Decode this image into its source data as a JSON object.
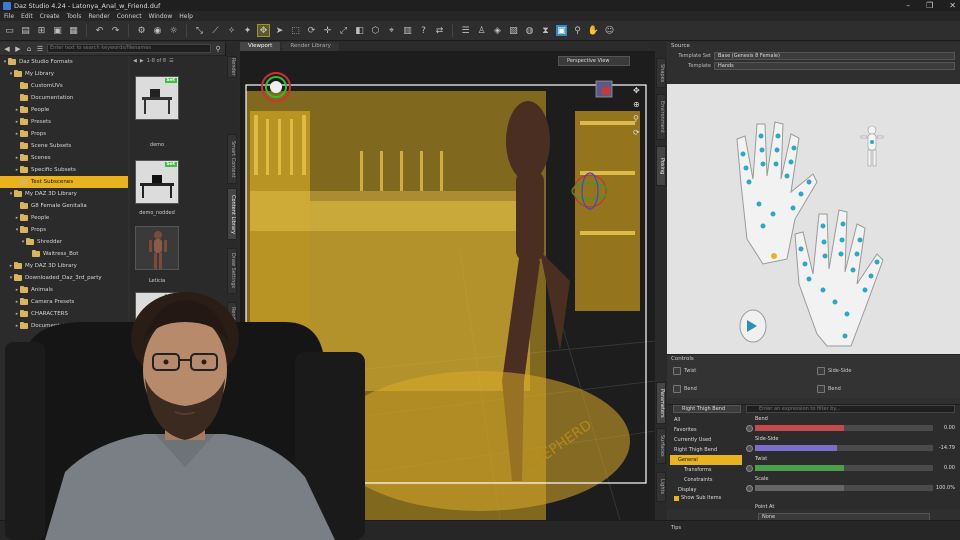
{
  "window": {
    "title": "Daz Studio 4.24 - Latonya_Anal_w_Friend.duf",
    "controls": [
      "–",
      "❐",
      "✕"
    ]
  },
  "menu": [
    "File",
    "Edit",
    "Create",
    "Tools",
    "Render",
    "Connect",
    "Window",
    "Help"
  ],
  "content_library": {
    "search_placeholder": "Enter text to search keywords/filenames",
    "page_indicator": "1-8 of 8",
    "tree": [
      {
        "label": "Daz Studio Formats",
        "depth": 0,
        "caret": "▾",
        "selected": false
      },
      {
        "label": "My Library",
        "depth": 1,
        "caret": "▾",
        "selected": false
      },
      {
        "label": "CustomUVs",
        "depth": 2,
        "caret": "",
        "selected": false
      },
      {
        "label": "Documentation",
        "depth": 2,
        "caret": "",
        "selected": false
      },
      {
        "label": "People",
        "depth": 2,
        "caret": "▸",
        "selected": false
      },
      {
        "label": "Presets",
        "depth": 2,
        "caret": "▸",
        "selected": false
      },
      {
        "label": "Props",
        "depth": 2,
        "caret": "▸",
        "selected": false
      },
      {
        "label": "Scene Subsets",
        "depth": 2,
        "caret": "",
        "selected": false
      },
      {
        "label": "Scenes",
        "depth": 2,
        "caret": "▸",
        "selected": false
      },
      {
        "label": "Specific Subsets",
        "depth": 2,
        "caret": "▸",
        "selected": false
      },
      {
        "label": "Test Subscenes",
        "depth": 2,
        "caret": "",
        "selected": true
      },
      {
        "label": "My DAZ 3D Library",
        "depth": 1,
        "caret": "▾",
        "selected": false
      },
      {
        "label": "G8 Female Genitalia",
        "depth": 2,
        "caret": "",
        "selected": false
      },
      {
        "label": "People",
        "depth": 2,
        "caret": "▸",
        "selected": false
      },
      {
        "label": "Props",
        "depth": 2,
        "caret": "▾",
        "selected": false
      },
      {
        "label": "Shredder",
        "depth": 3,
        "caret": "▾",
        "selected": false
      },
      {
        "label": "Waitress_Bot",
        "depth": 4,
        "caret": "",
        "selected": false
      },
      {
        "label": "My DAZ 3D Library",
        "depth": 1,
        "caret": "▸",
        "selected": false
      },
      {
        "label": "Downloaded_Daz_3rd_party",
        "depth": 1,
        "caret": "▾",
        "selected": false
      },
      {
        "label": "Animals",
        "depth": 2,
        "caret": "▸",
        "selected": false
      },
      {
        "label": "Camera Presets",
        "depth": 2,
        "caret": "▸",
        "selected": false
      },
      {
        "label": "CHARACTERS",
        "depth": 2,
        "caret": "▸",
        "selected": false
      },
      {
        "label": "Documentation",
        "depth": 2,
        "caret": "▸",
        "selected": false
      }
    ],
    "thumbs": [
      {
        "label": "demo",
        "badge": "Set"
      },
      {
        "label": "demo_nodded",
        "badge": "Set"
      },
      {
        "label": "Leticia",
        "badge": "Set"
      },
      {
        "label": "",
        "badge": "Set"
      }
    ],
    "side_tabs": [
      "Smart Content",
      "Content Library",
      "Draw Settings",
      "Render Settings"
    ],
    "top_tab": "Render"
  },
  "viewport": {
    "tabs": [
      "Viewport",
      "Render Library"
    ],
    "camera": "Perspective View",
    "floor_text": "SHEPHERD"
  },
  "right_tabs_top": [
    "Shapes",
    "Environment",
    "Posing"
  ],
  "right_tabs_bottom": [
    "Parameters",
    "Surfaces",
    "Lights"
  ],
  "pose_tools": {
    "header": "Source",
    "template_set_label": "Template Set",
    "template_set_value": "Base (Genesis 8 Female)",
    "template_label": "Template",
    "template_value": "Hands",
    "controls_header": "Controls",
    "controls": [
      "Twist",
      "Side-Side",
      "Bend",
      "Bend"
    ]
  },
  "parameters": {
    "node_dropdown": "Right Thigh Bend",
    "filter_placeholder": "Enter an expression to filter by...",
    "tree": [
      {
        "label": "All",
        "selected": false
      },
      {
        "label": "Favorites",
        "selected": false
      },
      {
        "label": "Currently Used",
        "selected": false
      },
      {
        "label": "Right Thigh Bend",
        "selected": false
      },
      {
        "label": "General",
        "selected": true
      },
      {
        "label": "Transforms",
        "selected": false
      },
      {
        "label": "Constraints",
        "selected": false
      },
      {
        "label": "Display",
        "selected": false
      }
    ],
    "show_sub_items": "Show Sub Items",
    "sliders": [
      {
        "label": "Bend",
        "value": "0.00",
        "fraction": 0.5,
        "color": "#c24a4a"
      },
      {
        "label": "Side-Side",
        "value": "-14.79",
        "fraction": 0.46,
        "color": "#7a6fc8"
      },
      {
        "label": "Twist",
        "value": "0.00",
        "fraction": 0.5,
        "color": "#4aa04a"
      },
      {
        "label": "Scale",
        "value": "100.0%",
        "fraction": 0.5,
        "color": "#666666"
      }
    ],
    "point_at_label": "Point At",
    "point_at_value": "None",
    "tips": "Tips"
  },
  "colors": {
    "selection": "#e9b320",
    "accent_blue": "#2a8fc0",
    "overlay_yellow": "#f0c020"
  }
}
